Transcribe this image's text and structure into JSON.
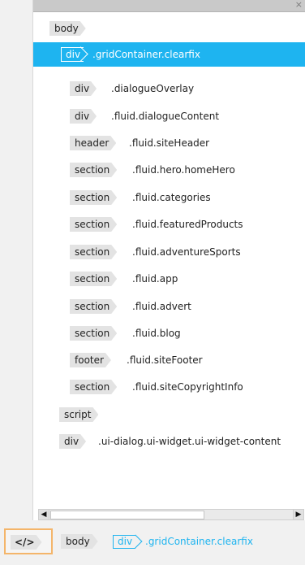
{
  "panel": {
    "close_glyph": "×",
    "tree": [
      {
        "tag": "body",
        "cls": ""
      },
      {
        "tag": "div",
        "cls": ".gridContainer.clearfix",
        "selected": true
      },
      {
        "tag": "div",
        "cls": ".dialogueOverlay"
      },
      {
        "tag": "div",
        "cls": ".fluid.dialogueContent"
      },
      {
        "tag": "header",
        "cls": ".fluid.siteHeader"
      },
      {
        "tag": "section",
        "cls": ".fluid.hero.homeHero"
      },
      {
        "tag": "section",
        "cls": ".fluid.categories"
      },
      {
        "tag": "section",
        "cls": ".fluid.featuredProducts"
      },
      {
        "tag": "section",
        "cls": ".fluid.adventureSports"
      },
      {
        "tag": "section",
        "cls": ".fluid.app"
      },
      {
        "tag": "section",
        "cls": ".fluid.advert"
      },
      {
        "tag": "section",
        "cls": ".fluid.blog"
      },
      {
        "tag": "footer",
        "cls": ".fluid.siteFooter"
      },
      {
        "tag": "section",
        "cls": ".fluid.siteCopyrightInfo"
      },
      {
        "tag": "script",
        "cls": ""
      },
      {
        "tag": "div",
        "cls": ".ui-dialog.ui-widget.ui-widget-content"
      }
    ],
    "scroll_left_glyph": "◀",
    "scroll_right_glyph": "▶"
  },
  "statusbar": {
    "code_label": "</>",
    "crumb_body": "body",
    "crumb_div": "div",
    "crumb_cls": ".gridContainer.clearfix"
  },
  "colors": {
    "accent": "#1eb4f0",
    "highlight_border": "#f4b56a"
  }
}
